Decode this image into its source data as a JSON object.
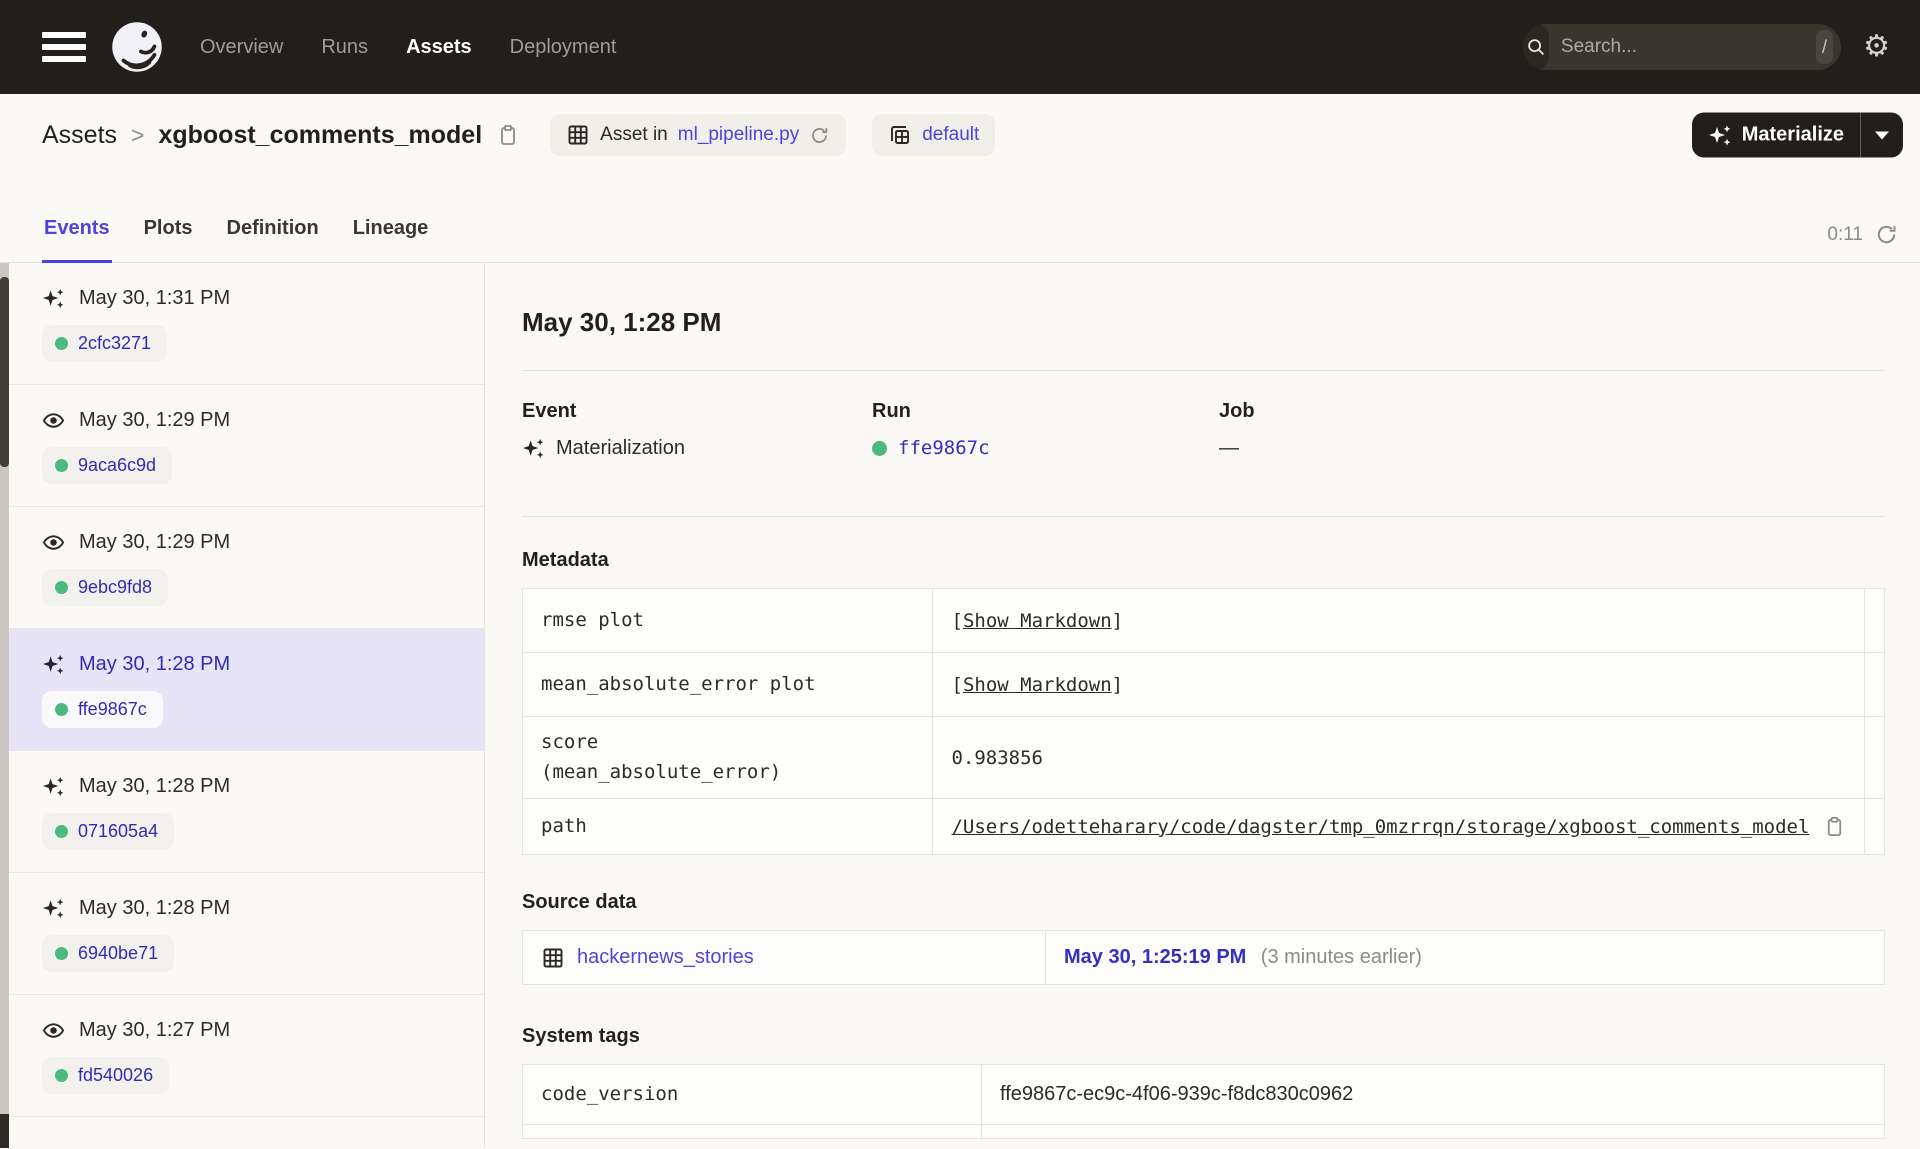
{
  "colors": {
    "header_bg": "#211E1B",
    "page_bg": "#FAF9F6",
    "accent_blurple": "#4F43DD",
    "run_link": "#352FC0",
    "success_green": "#4CB980",
    "selected_row_bg": "#E6E4F6"
  },
  "header": {
    "nav": [
      {
        "label": "Overview",
        "active": false
      },
      {
        "label": "Runs",
        "active": false
      },
      {
        "label": "Assets",
        "active": true
      },
      {
        "label": "Deployment",
        "active": false
      }
    ],
    "search": {
      "placeholder": "Search...",
      "shortcut": "/"
    },
    "gear_glyph": "⚙"
  },
  "breadcrumb": {
    "root": "Assets",
    "separator": ">",
    "asset": "xgboost_comments_model"
  },
  "badges": {
    "asset_in_prefix": "Asset in",
    "asset_in_link": "ml_pipeline.py",
    "group": "default"
  },
  "materialize": {
    "label": "Materialize"
  },
  "tabs": {
    "items": [
      {
        "label": "Events",
        "active": true
      },
      {
        "label": "Plots",
        "active": false
      },
      {
        "label": "Definition",
        "active": false
      },
      {
        "label": "Lineage",
        "active": false
      }
    ],
    "timer": "0:11"
  },
  "sidebar": {
    "items": [
      {
        "type": "materialization",
        "time": "May 30, 1:31 PM",
        "run_id": "2cfc3271",
        "selected": false
      },
      {
        "type": "observation",
        "time": "May 30, 1:29 PM",
        "run_id": "9aca6c9d",
        "selected": false
      },
      {
        "type": "observation",
        "time": "May 30, 1:29 PM",
        "run_id": "9ebc9fd8",
        "selected": false
      },
      {
        "type": "materialization",
        "time": "May 30, 1:28 PM",
        "run_id": "ffe9867c",
        "selected": true
      },
      {
        "type": "materialization",
        "time": "May 30, 1:28 PM",
        "run_id": "071605a4",
        "selected": false
      },
      {
        "type": "materialization",
        "time": "May 30, 1:28 PM",
        "run_id": "6940be71",
        "selected": false
      },
      {
        "type": "observation",
        "time": "May 30, 1:27 PM",
        "run_id": "fd540026",
        "selected": false
      }
    ]
  },
  "detail": {
    "title": "May 30, 1:28 PM",
    "event": {
      "label": "Event",
      "value": "Materialization"
    },
    "run": {
      "label": "Run",
      "value": "ffe9867c"
    },
    "job": {
      "label": "Job",
      "value": "—"
    },
    "metadata": {
      "heading": "Metadata",
      "rows": [
        {
          "key": "rmse plot",
          "pre": "[",
          "link": "Show Markdown",
          "post": "]"
        },
        {
          "key": "mean_absolute_error plot",
          "pre": "[",
          "link": "Show Markdown",
          "post": "]"
        },
        {
          "key": "score\n(mean_absolute_error)",
          "value": "0.983856"
        },
        {
          "key": "path",
          "value": "/Users/odetteharary/code/dagster/tmp_0mzrrqn/storage/xgboost_comments_model"
        }
      ]
    },
    "source_data": {
      "heading": "Source data",
      "asset": "hackernews_stories",
      "time": "May 30, 1:25:19 PM",
      "relative": "(3 minutes earlier)"
    },
    "system_tags": {
      "heading": "System tags",
      "rows": [
        {
          "key": "code_version",
          "value": "ffe9867c-ec9c-4f06-939c-f8dc830c0962"
        }
      ]
    }
  }
}
